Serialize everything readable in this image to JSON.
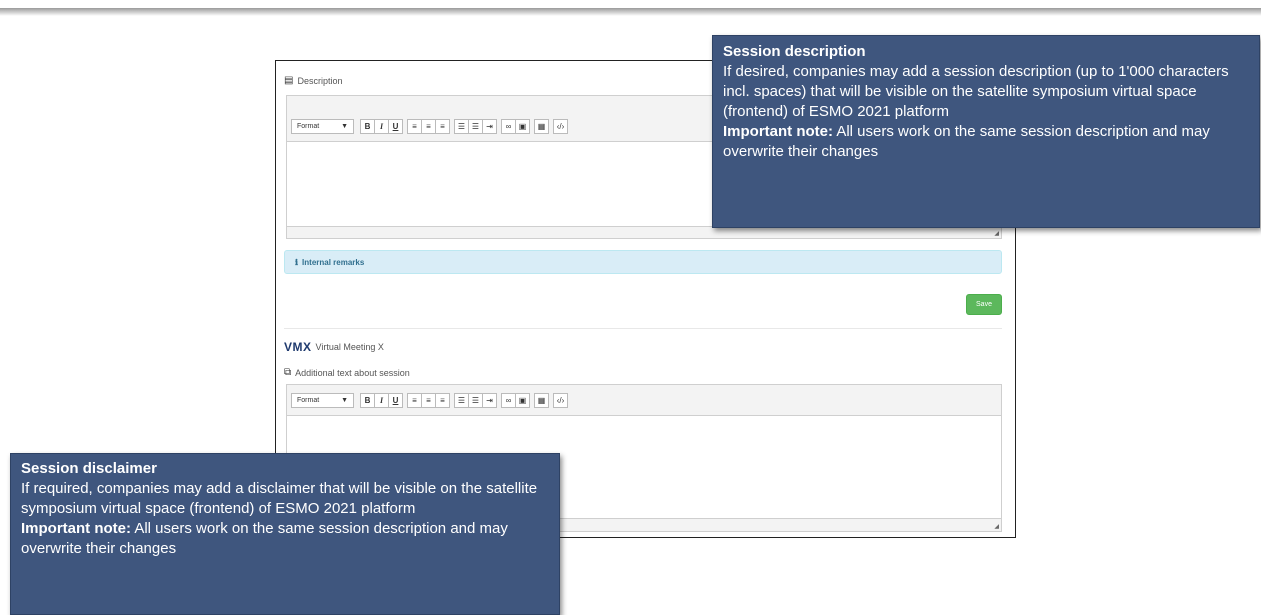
{
  "description_field": {
    "label": "Description"
  },
  "editor": {
    "format_label": "Format",
    "buttons": {
      "bold": "B",
      "italic": "I",
      "underline": "U",
      "align_left": "≡",
      "align_center": "≡",
      "align_right": "≡",
      "bullets": "☰",
      "numbers": "☰",
      "indent": "⇥",
      "link": "∞",
      "image": "▣",
      "table": "▦",
      "source": "‹/›"
    }
  },
  "remarks": {
    "label": "Internal remarks"
  },
  "save": {
    "label": "Save"
  },
  "vmx": {
    "logo": "VMX",
    "name": "Virtual Meeting X"
  },
  "additional_field": {
    "label": "Additional text about session"
  },
  "callout_description": {
    "title": "Session description",
    "body": "If desired, companies may add a session description (up to 1'000 characters incl. spaces) that will be visible on the satellite symposium virtual space (frontend) of ESMO 2021 platform",
    "note_label": "Important note:",
    "note_text": " All users work on the same session description and may overwrite their changes"
  },
  "callout_disclaimer": {
    "title": "Session disclaimer",
    "body": "If required, companies may add a disclaimer that will be visible on the satellite symposium virtual space (frontend) of ESMO 2021 platform",
    "note_label": "Important note:",
    "note_text": " All users work on the same session description and may overwrite their changes"
  },
  "colors": {
    "callout_bg": "#3f567e",
    "save_green": "#5cb85c",
    "info_bg": "#d9edf7"
  }
}
